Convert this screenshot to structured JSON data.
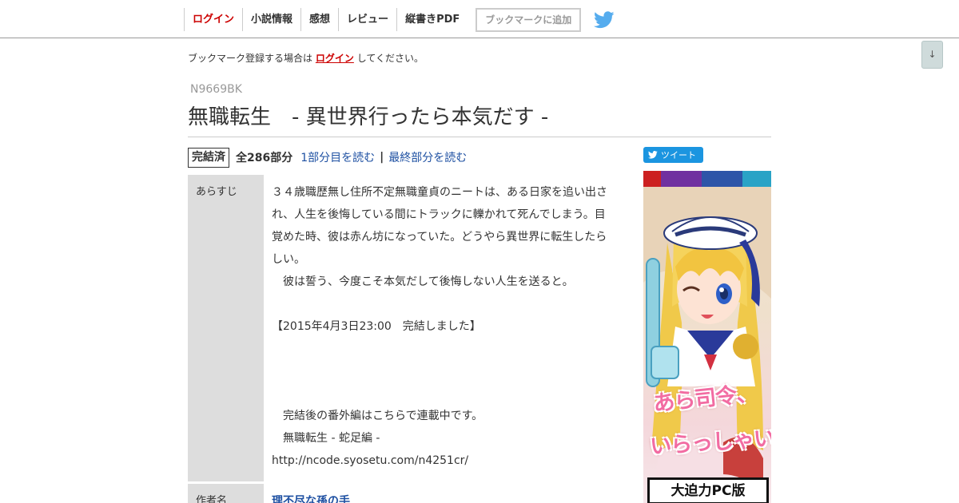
{
  "nav": {
    "items": [
      {
        "label": "ログイン",
        "name": "nav-login"
      },
      {
        "label": "小説情報",
        "name": "nav-novel-info"
      },
      {
        "label": "感想",
        "name": "nav-impressions"
      },
      {
        "label": "レビュー",
        "name": "nav-review"
      },
      {
        "label": "縦書きPDF",
        "name": "nav-vertical-pdf"
      }
    ],
    "bookmark_label": "ブックマークに追加",
    "twitter_icon": "twitter-bird-icon"
  },
  "scroll_button": "↓",
  "notice": {
    "before": "ブックマーク登録する場合は",
    "link": "ログイン",
    "after": "してください。"
  },
  "novel": {
    "ncode": "N9669BK",
    "title": "無職転生　- 異世界行ったら本気だす -",
    "status": "完結済",
    "total": "全286部分",
    "first_link": "1部分目を読む",
    "separator": "|",
    "last_link": "最終部分を読む"
  },
  "info": {
    "synopsis_label": "あらすじ",
    "synopsis_lines": [
      "３４歳職歴無し住所不定無職童貞のニートは、ある日家を追い出さ",
      "れ、人生を後悔している間にトラックに轢かれて死んでしまう。目",
      "覚めた時、彼は赤ん坊になっていた。どうやら異世界に転生したら",
      "しい。",
      "　彼は誓う、今度こそ本気だして後悔しない人生を送ると。",
      "",
      "【2015年4月3日23:00　完結しました】",
      "",
      "",
      "",
      "　完結後の番外編はこちらで連載中です。",
      "　無職転生 - 蛇足編 -",
      "http://ncode.syosetu.com/n4251cr/"
    ],
    "author_label": "作者名",
    "author": "理不尽な孫の手"
  },
  "tweet_label": "ツイート",
  "ad": {
    "caption1": "あら司令、",
    "caption2": "いらっしゃい",
    "badge": "大迫力PC版",
    "colors": [
      "#cc2020",
      "#7030a0",
      "#2d55a8",
      "#29a3c6"
    ]
  }
}
